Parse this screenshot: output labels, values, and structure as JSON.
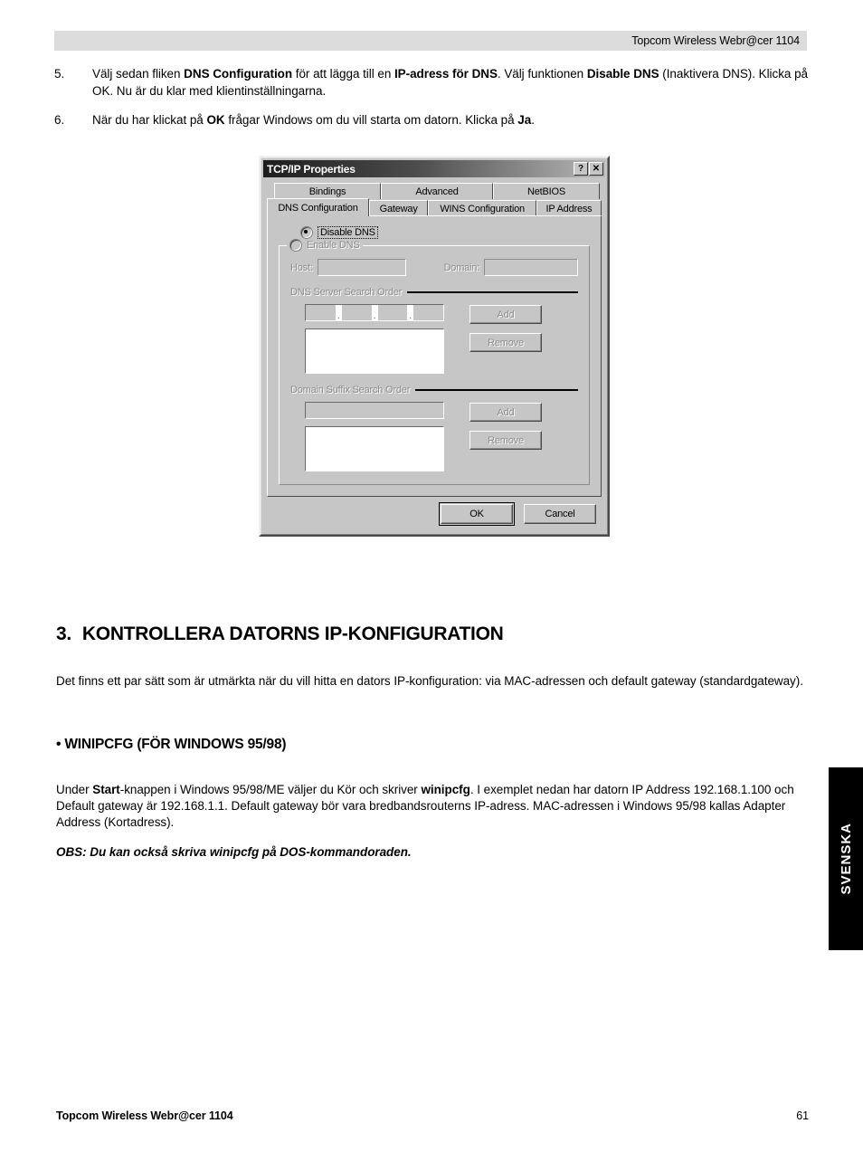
{
  "header": {
    "running_title": "Topcom Wireless Webr@cer 1104"
  },
  "steps": [
    {
      "number": "5.",
      "segments": [
        {
          "t": "Välj sedan fliken ",
          "b": false
        },
        {
          "t": "DNS Configuration",
          "b": true
        },
        {
          "t": " för att lägga till en ",
          "b": false
        },
        {
          "t": "IP-adress för DNS",
          "b": true
        },
        {
          "t": ". Välj funktionen ",
          "b": false
        },
        {
          "t": "Disable DNS",
          "b": true
        },
        {
          "t": " (Inaktivera DNS). Klicka på OK. Nu är du klar med klientinställningarna.",
          "b": false
        }
      ]
    },
    {
      "number": "6.",
      "segments": [
        {
          "t": "När du har klickat på ",
          "b": false
        },
        {
          "t": "OK",
          "b": true
        },
        {
          "t": " frågar Windows om du vill starta om datorn. Klicka på ",
          "b": false
        },
        {
          "t": "Ja",
          "b": true
        },
        {
          "t": ".",
          "b": false
        }
      ]
    }
  ],
  "dialog": {
    "title": "TCP/IP Properties",
    "help_button": "?",
    "close_button": "✕",
    "tabs_row1": [
      "Bindings",
      "Advanced",
      "NetBIOS"
    ],
    "tabs_row2": [
      "DNS Configuration",
      "Gateway",
      "WINS Configuration",
      "IP Address"
    ],
    "active_tab": "DNS Configuration",
    "radio_disable": "Disable DNS",
    "radio_enable": "Enable DNS",
    "selected_radio": "Disable DNS",
    "host_label": "Host:",
    "host_value": "",
    "domain_label": "Domain:",
    "domain_value": "",
    "dns_section_label": "DNS Server Search Order",
    "dns_ip_octets": [
      "",
      "",
      "",
      ""
    ],
    "dns_ip_separator": ".",
    "dns_list_items": [],
    "dns_add_label": "Add",
    "dns_remove_label": "Remove",
    "suffix_section_label": "Domain Suffix Search Order",
    "suffix_value": "",
    "suffix_list_items": [],
    "suffix_add_label": "Add",
    "suffix_remove_label": "Remove",
    "ok_label": "OK",
    "cancel_label": "Cancel"
  },
  "section": {
    "number": "3.",
    "title": "KONTROLLERA DATORNS IP-KONFIGURATION",
    "intro": "Det finns ett par sätt som är utmärkta när du vill hitta en dators IP-konfiguration: via MAC-adressen och default gateway (standardgateway).",
    "sub_title": "• WINIPCFG (FÖR WINDOWS 95/98)",
    "winipcfg_segments": [
      {
        "t": "Under ",
        "b": false
      },
      {
        "t": "Start",
        "b": true
      },
      {
        "t": "-knappen i Windows 95/98/ME väljer du Kör och skriver ",
        "b": false
      },
      {
        "t": "winipcfg",
        "b": true
      },
      {
        "t": ". I exemplet nedan har datorn IP Address 192.168.1.100 och Default gateway är 192.168.1.1. Default gateway bör vara bredbandsrouterns IP-adress. MAC-adressen i Windows 95/98 kallas Adapter Address (Kortadress).",
        "b": false
      }
    ],
    "note": "OBS: Du kan också skriva winipcfg på DOS-kommandoraden."
  },
  "language_tab": {
    "label": "SVENSKA"
  },
  "footer": {
    "left": "Topcom Wireless Webr@cer 1104",
    "page": "61"
  }
}
